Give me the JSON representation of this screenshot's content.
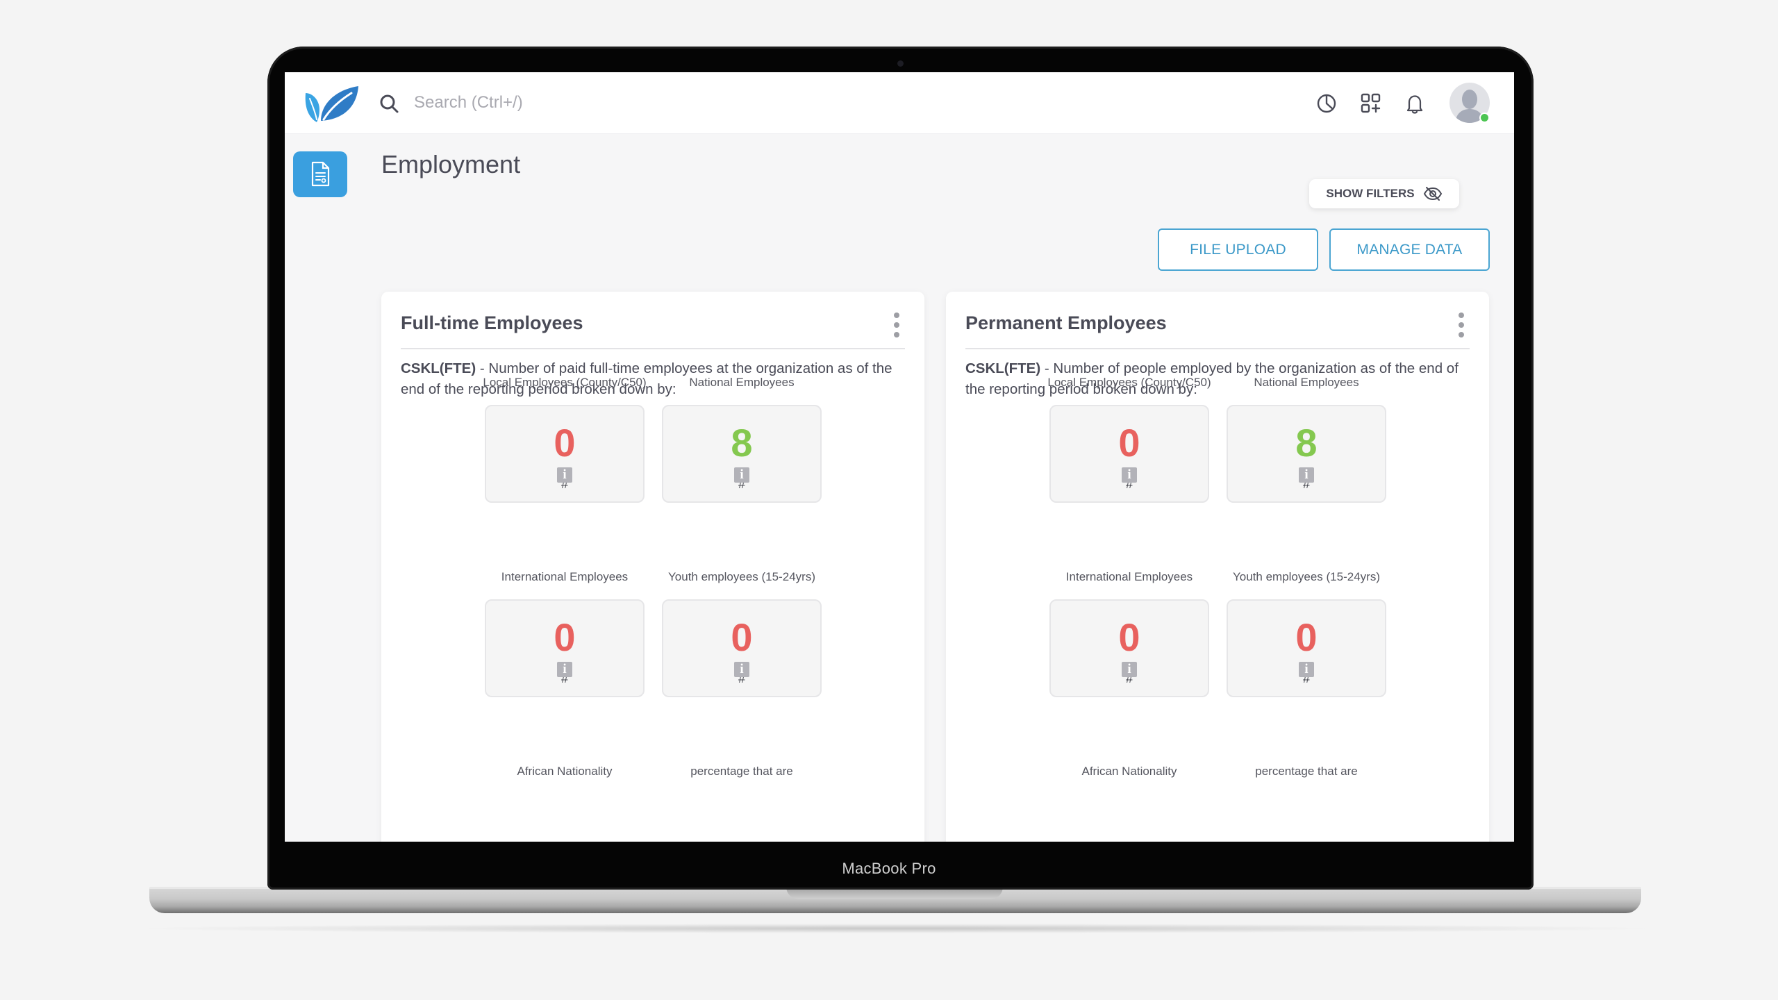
{
  "device": {
    "label": "MacBook Pro"
  },
  "header": {
    "search_placeholder": "Search (Ctrl+/)",
    "icons": [
      "pie-chart-icon",
      "add-widget-icon",
      "bell-icon",
      "avatar"
    ],
    "user_status": "online"
  },
  "sidebar": {
    "active_item": "document-icon"
  },
  "page": {
    "title": "Employment",
    "show_filters_label": "SHOW FILTERS",
    "file_upload_label": "FILE UPLOAD",
    "manage_data_label": "MANAGE DATA"
  },
  "colors": {
    "accent": "#3a9fdf",
    "button_outline": "#4ba5d2",
    "zero_value": "#e8615e",
    "positive_value": "#84c84f",
    "status_online": "#4cc552"
  },
  "cards": [
    {
      "title": "Full-time Employees",
      "code": "CSKL(FTE)",
      "description": " - Number of paid full-time employees at the organization as of the end of the reporting period broken down by:",
      "metrics": [
        {
          "label": "Local Employees (County/C50)",
          "value": "0",
          "unit": "#"
        },
        {
          "label": "National Employees",
          "value": "8",
          "unit": "#"
        },
        {
          "label": "International Employees",
          "value": "0",
          "unit": "#"
        },
        {
          "label": "Youth employees (15-24yrs)",
          "value": "0",
          "unit": "#"
        }
      ],
      "next_labels": [
        "African Nationality",
        "percentage that are"
      ]
    },
    {
      "title": "Permanent Employees",
      "code": "CSKL(FTE)",
      "description": " - Number of people employed by the organization as of the end of the reporting period broken down by:",
      "metrics": [
        {
          "label": "Local Employees (County/C50)",
          "value": "0",
          "unit": "#"
        },
        {
          "label": "National Employees",
          "value": "8",
          "unit": "#"
        },
        {
          "label": "International Employees",
          "value": "0",
          "unit": "#"
        },
        {
          "label": "Youth employees (15-24yrs)",
          "value": "0",
          "unit": "#"
        }
      ],
      "next_labels": [
        "African Nationality",
        "percentage that are"
      ]
    }
  ]
}
